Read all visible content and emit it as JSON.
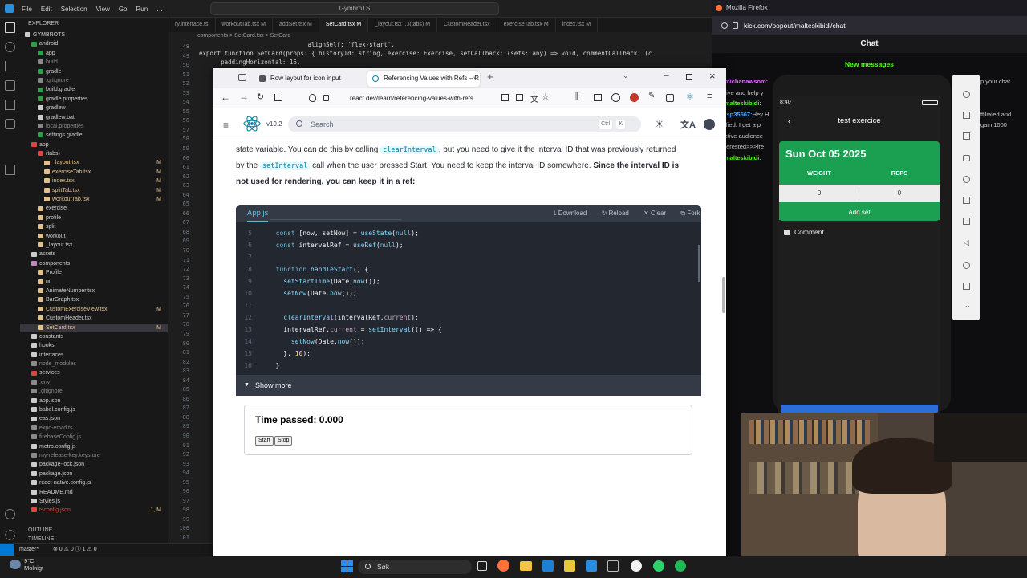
{
  "vscode": {
    "menu": [
      "File",
      "Edit",
      "Selection",
      "View",
      "Go",
      "Run",
      "…"
    ],
    "search": "GymbroTS",
    "explorer_title": "EXPLORER",
    "tree": [
      {
        "label": "GYMBROTS",
        "depth": 0,
        "color": "#ccc",
        "mark": ""
      },
      {
        "label": "android",
        "depth": 1,
        "color": "#2e9f4a",
        "mark": ""
      },
      {
        "label": "app",
        "depth": 2,
        "color": "#2e9f4a",
        "mark": ""
      },
      {
        "label": "build",
        "depth": 2,
        "color": "#8a8a8a",
        "mark": ""
      },
      {
        "label": "gradle",
        "depth": 2,
        "color": "#2e9f4a",
        "mark": ""
      },
      {
        "label": ".gitignore",
        "depth": 2,
        "color": "#888",
        "mark": ""
      },
      {
        "label": "build.gradle",
        "depth": 2,
        "color": "#2e9f4a",
        "mark": ""
      },
      {
        "label": "gradle.properties",
        "depth": 2,
        "color": "#2e9f4a",
        "mark": ""
      },
      {
        "label": "gradlew",
        "depth": 2,
        "color": "#ccc",
        "mark": ""
      },
      {
        "label": "gradlew.bat",
        "depth": 2,
        "color": "#ccc",
        "mark": ""
      },
      {
        "label": "local.properties",
        "depth": 2,
        "color": "#888",
        "mark": ""
      },
      {
        "label": "settings.gradle",
        "depth": 2,
        "color": "#2e9f4a",
        "mark": ""
      },
      {
        "label": "app",
        "depth": 1,
        "color": "#e04343",
        "mark": ""
      },
      {
        "label": "(tabs)",
        "depth": 2,
        "color": "#e04343",
        "mark": ""
      },
      {
        "label": "_layout.tsx",
        "depth": 3,
        "color": "#e2c08d",
        "mark": "M"
      },
      {
        "label": "exerciseTab.tsx",
        "depth": 3,
        "color": "#e2c08d",
        "mark": "M"
      },
      {
        "label": "index.tsx",
        "depth": 3,
        "color": "#e2c08d",
        "mark": "M"
      },
      {
        "label": "splitTab.tsx",
        "depth": 3,
        "color": "#e2c08d",
        "mark": "M"
      },
      {
        "label": "workoutTab.tsx",
        "depth": 3,
        "color": "#e2c08d",
        "mark": "M"
      },
      {
        "label": "exercise",
        "depth": 2,
        "color": "#e2c08d",
        "mark": ""
      },
      {
        "label": "profile",
        "depth": 2,
        "color": "#e2c08d",
        "mark": ""
      },
      {
        "label": "split",
        "depth": 2,
        "color": "#e2c08d",
        "mark": ""
      },
      {
        "label": "workout",
        "depth": 2,
        "color": "#e2c08d",
        "mark": ""
      },
      {
        "label": "_layout.tsx",
        "depth": 2,
        "color": "#e2c08d",
        "mark": ""
      },
      {
        "label": "assets",
        "depth": 1,
        "color": "#ccc",
        "mark": ""
      },
      {
        "label": "components",
        "depth": 1,
        "color": "#c586c0",
        "mark": ""
      },
      {
        "label": "Profile",
        "depth": 2,
        "color": "#e2c08d",
        "mark": ""
      },
      {
        "label": "ui",
        "depth": 2,
        "color": "#e2c08d",
        "mark": ""
      },
      {
        "label": "AnimateNumber.tsx",
        "depth": 2,
        "color": "#e2c08d",
        "mark": ""
      },
      {
        "label": "BarGraph.tsx",
        "depth": 2,
        "color": "#e2c08d",
        "mark": ""
      },
      {
        "label": "CustomExerciseView.tsx",
        "depth": 2,
        "color": "#e2c08d",
        "mark": "M"
      },
      {
        "label": "CustomHeader.tsx",
        "depth": 2,
        "color": "#e2c08d",
        "mark": ""
      },
      {
        "label": "SetCard.tsx",
        "depth": 2,
        "color": "#e2c08d",
        "mark": "M",
        "active": true
      },
      {
        "label": "constants",
        "depth": 1,
        "color": "#ccc",
        "mark": ""
      },
      {
        "label": "hooks",
        "depth": 1,
        "color": "#ccc",
        "mark": ""
      },
      {
        "label": "interfaces",
        "depth": 1,
        "color": "#ccc",
        "mark": ""
      },
      {
        "label": "node_modules",
        "depth": 1,
        "color": "#8a8a8a",
        "mark": ""
      },
      {
        "label": "services",
        "depth": 1,
        "color": "#e04343",
        "mark": ""
      },
      {
        "label": ".env",
        "depth": 1,
        "color": "#8a8a8a",
        "mark": ""
      },
      {
        "label": ".gitignore",
        "depth": 1,
        "color": "#888",
        "mark": ""
      },
      {
        "label": "app.json",
        "depth": 1,
        "color": "#ccc",
        "mark": ""
      },
      {
        "label": "babel.config.js",
        "depth": 1,
        "color": "#ccc",
        "mark": ""
      },
      {
        "label": "eas.json",
        "depth": 1,
        "color": "#ccc",
        "mark": ""
      },
      {
        "label": "expo-env.d.ts",
        "depth": 1,
        "color": "#8a8a8a",
        "mark": ""
      },
      {
        "label": "firebaseConfig.js",
        "depth": 1,
        "color": "#8a8a8a",
        "mark": ""
      },
      {
        "label": "metro.config.js",
        "depth": 1,
        "color": "#ccc",
        "mark": ""
      },
      {
        "label": "my-release-key.keystore",
        "depth": 1,
        "color": "#8a8a8a",
        "mark": ""
      },
      {
        "label": "package-lock.json",
        "depth": 1,
        "color": "#ccc",
        "mark": ""
      },
      {
        "label": "package.json",
        "depth": 1,
        "color": "#ccc",
        "mark": ""
      },
      {
        "label": "react-native.config.js",
        "depth": 1,
        "color": "#ccc",
        "mark": ""
      },
      {
        "label": "README.md",
        "depth": 1,
        "color": "#ccc",
        "mark": ""
      },
      {
        "label": "Styles.js",
        "depth": 1,
        "color": "#ccc",
        "mark": ""
      },
      {
        "label": "tsconfig.json",
        "depth": 1,
        "color": "#e04343",
        "mark": "1, M"
      }
    ],
    "outline": "OUTLINE",
    "timeline": "TIMELINE",
    "tabs": [
      "ry.interface.ts",
      "workoutTab.tsx M",
      "addSet.tsx M",
      "SetCard.tsx M",
      "_layout.tsx ...\\(tabs) M",
      "CustomHeader.tsx",
      "exerciseTab.tsx M",
      "index.tsx M"
    ],
    "breadcrumb": "components > SetCard.tsx > SetCard",
    "code_top": [
      "                              alignSelf: 'flex-start',",
      "export function SetCard(props: { historyId: string, exercise: Exercise, setCallback: (sets: any) => void, commentCallback: (c",
      "      paddingHorizontal: 16,"
    ],
    "line_numbers": [
      48,
      49,
      50,
      51,
      52,
      53,
      54,
      55,
      56,
      57,
      58,
      59,
      60,
      61,
      62,
      63,
      64,
      65,
      66,
      67,
      68,
      69,
      70,
      71,
      72,
      73,
      74,
      75,
      76,
      77,
      78,
      79,
      80,
      81,
      82,
      83,
      84,
      85,
      86,
      87,
      88,
      89,
      90,
      91,
      92,
      93,
      94,
      95,
      96,
      97,
      98,
      99,
      100,
      101
    ],
    "status": {
      "branch": "master*",
      "problems": "⊗ 0 ⚠ 0  ⓘ 1 ⚠ 0"
    }
  },
  "firefox": {
    "title": "Mozilla Firefox",
    "url": "kick.com/popout/malteskibidi/chat",
    "chat_title": "Chat",
    "new_messages": "New messages",
    "chat_lines": [
      {
        "user": "michanawsom:",
        "text": "",
        "color": "#e06cff"
      },
      {
        "user": "",
        "text": "tive and help y",
        "color": "#c8c8c8"
      },
      {
        "user": "malteskibidi:",
        "text": "",
        "color": "#53fc18"
      },
      {
        "user": "tsp35567:",
        "text": "Hey H",
        "color": "#4aa8ff"
      },
      {
        "user": "",
        "text": "ified. I get a p",
        "color": "#c8c8c8"
      },
      {
        "user": "",
        "text": "ctive audience",
        "color": "#c8c8c8"
      },
      {
        "user": "",
        "text": "terested>>>fre",
        "color": "#c8c8c8"
      },
      {
        "user": "malteskibidi:",
        "text": "",
        "color": "#53fc18"
      }
    ],
    "chat_right": [
      "p your chat",
      "ffiliated and",
      "gain 1000"
    ]
  },
  "browser": {
    "tabs": [
      {
        "label": "Row layout for icon input"
      },
      {
        "label": "Referencing Values with Refs – R"
      }
    ],
    "url": "react.dev/learn/referencing-values-with-refs",
    "version": "v19.2",
    "search_placeholder": "Search",
    "search_kbd": [
      "Ctrl",
      "K"
    ],
    "prose": {
      "p1a": "state variable. You can do this by calling ",
      "code1": "clearInterval",
      "p1b": ", but you need to give it the interval ID that was previously returned by the ",
      "code2": "setInterval",
      "p1c": " call when the user pressed Start. You need to keep the interval ID somewhere. ",
      "bold": "Since the interval ID is not used for rendering, you can keep it in a ref:"
    },
    "sandbox": {
      "file": "App.js",
      "actions": [
        "Download",
        "Reload",
        "Clear",
        "Fork"
      ],
      "show_more": "Show more"
    },
    "preview": {
      "heading": "Time passed: 0.000",
      "start": "Start",
      "stop": "Stop"
    }
  },
  "code_lines": [
    {
      "n": "5",
      "html": "  <span class='kw'>const</span> [now, setNow] = <span class='fn'>useState</span>(<span class='kw'>null</span>);"
    },
    {
      "n": "6",
      "html": "  <span class='kw'>const</span> intervalRef = <span class='fn'>useRef</span>(<span class='kw'>null</span>);"
    },
    {
      "n": "7",
      "html": ""
    },
    {
      "n": "8",
      "html": "  <span class='kw'>function</span> <span class='fn'>handleStart</span>() {"
    },
    {
      "n": "9",
      "html": "    <span class='fn'>setStartTime</span>(Date.<span class='fn'>now</span>());"
    },
    {
      "n": "10",
      "html": "    <span class='fn'>setNow</span>(Date.<span class='fn'>now</span>());"
    },
    {
      "n": "11",
      "html": ""
    },
    {
      "n": "12",
      "html": "    <span class='fn'>clearInterval</span>(intervalRef.<span class='pr'>current</span>);"
    },
    {
      "n": "13",
      "html": "    intervalRef.<span class='pr'>current</span> = <span class='fn'>setInterval</span>(() =&gt; {"
    },
    {
      "n": "14",
      "html": "      <span class='fn'>setNow</span>(Date.<span class='fn'>now</span>());"
    },
    {
      "n": "15",
      "html": "    }, <span class='num'>10</span>);"
    },
    {
      "n": "16",
      "html": "  }"
    }
  ],
  "phone": {
    "time": "8:40",
    "title": "test exercice",
    "date": "Sun Oct 05 2025",
    "weight_label": "WEIGHT",
    "reps_label": "REPS",
    "weight": "0",
    "reps": "0",
    "add_set": "Add set",
    "comment": "Comment"
  },
  "taskbar": {
    "search": "Søk",
    "weather_temp": "9°C",
    "weather_desc": "Molnigt"
  },
  "colors": {
    "react_blue": "#087ea4",
    "app_green": "#1aa050",
    "kick_green": "#53fc18"
  }
}
